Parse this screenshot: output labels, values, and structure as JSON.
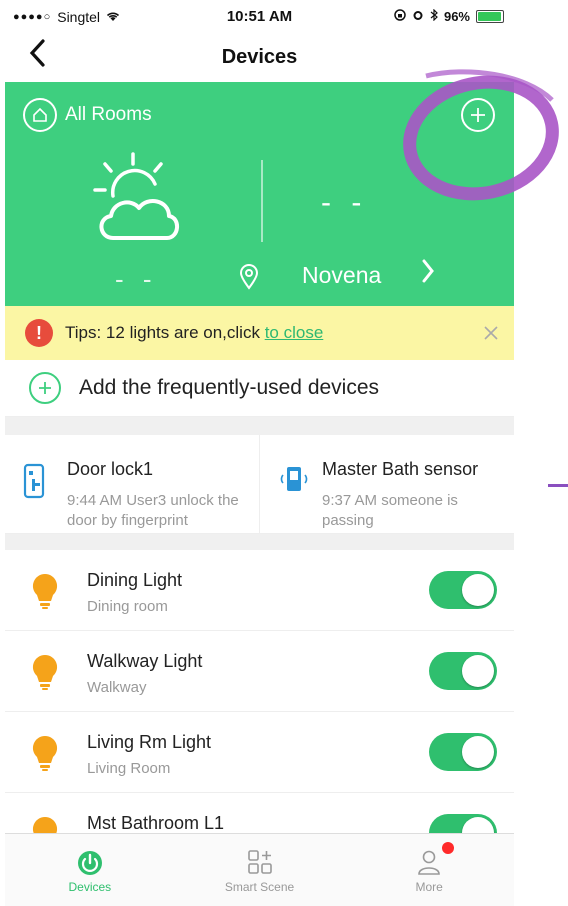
{
  "statusbar": {
    "carrier": "Singtel",
    "time": "10:51 AM",
    "battery": "96%"
  },
  "nav": {
    "title": "Devices"
  },
  "weather": {
    "rooms_label": "All Rooms",
    "temperature": "- -",
    "left_value": "- -",
    "location": "Novena"
  },
  "tips": {
    "text": "Tips: 12 lights are on,click ",
    "link": "to close"
  },
  "add": {
    "label": "Add the frequently-used devices"
  },
  "cards": [
    {
      "title": "Door lock1",
      "desc": "9:44 AM User3  unlock the door by fingerprint"
    },
    {
      "title": "Master Bath sensor",
      "desc": "9:37 AM someone is passing"
    }
  ],
  "devices": [
    {
      "name": "Dining Light",
      "room": "Dining room"
    },
    {
      "name": "Walkway Light",
      "room": "Walkway"
    },
    {
      "name": "Living Rm Light",
      "room": "Living Room"
    },
    {
      "name": "Mst Bathroom L1",
      "room": ""
    }
  ],
  "tabs": [
    {
      "label": "Devices"
    },
    {
      "label": "Smart Scene"
    },
    {
      "label": "More"
    }
  ],
  "colors": {
    "accent": "#3ecf7f",
    "tips_bg": "#fbf6a4",
    "bulb": "#f5a31a",
    "annotation": "#a855c7"
  }
}
